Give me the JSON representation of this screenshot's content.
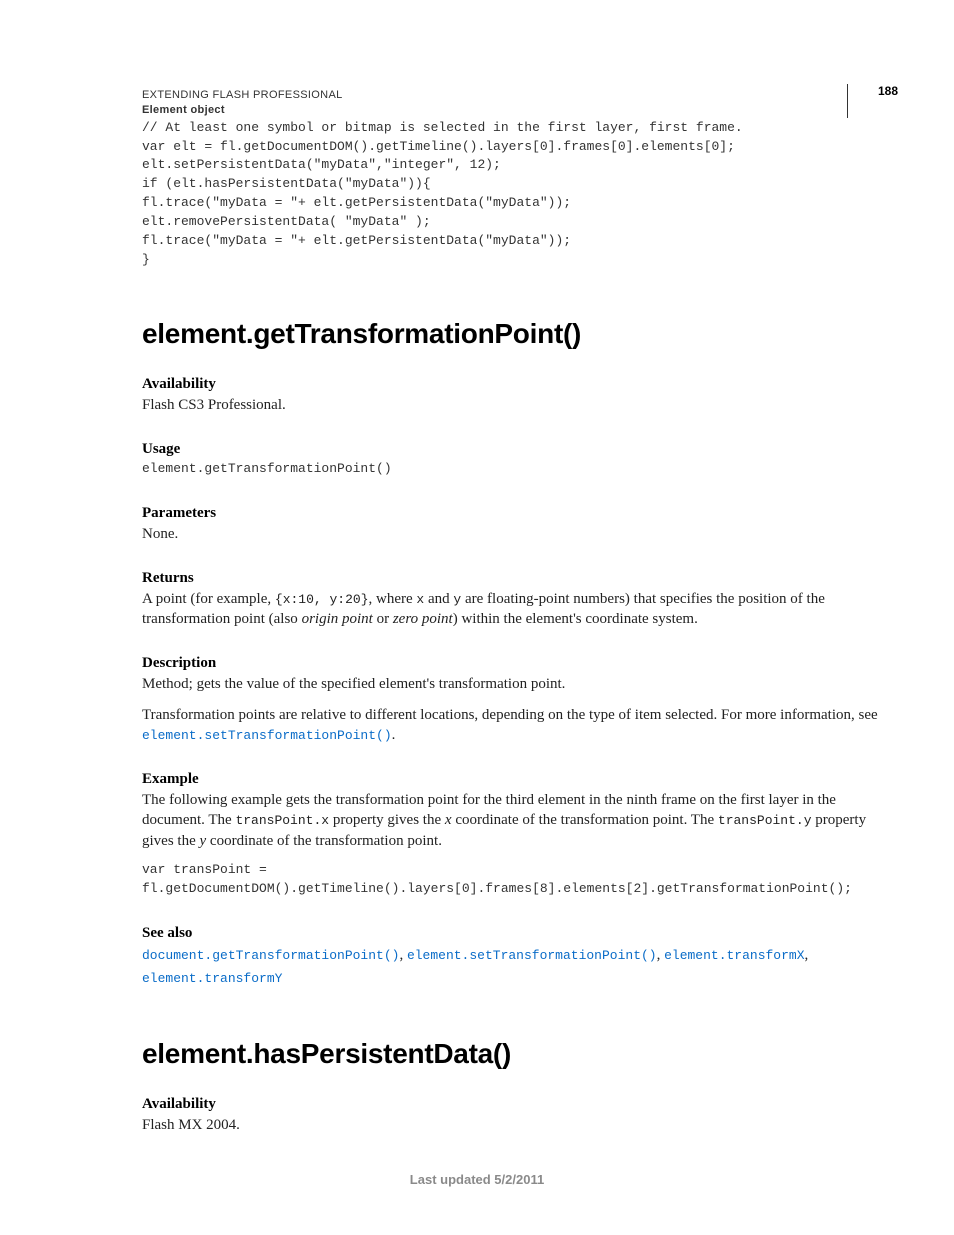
{
  "header": {
    "line1": "EXTENDING FLASH PROFESSIONAL",
    "line2": "Element object",
    "page": "188"
  },
  "code1": "// At least one symbol or bitmap is selected in the first layer, first frame.\nvar elt = fl.getDocumentDOM().getTimeline().layers[0].frames[0].elements[0];\nelt.setPersistentData(\"myData\",\"integer\", 12);\nif (elt.hasPersistentData(\"myData\")){\nfl.trace(\"myData = \"+ elt.getPersistentData(\"myData\"));\nelt.removePersistentData( \"myData\" );\nfl.trace(\"myData = \"+ elt.getPersistentData(\"myData\"));\n}",
  "s1": {
    "title": "element.getTransformationPoint()",
    "avail_h": "Availability",
    "avail_t": "Flash CS3 Professional.",
    "usage_h": "Usage",
    "usage_c": "element.getTransformationPoint()",
    "params_h": "Parameters",
    "params_t": "None.",
    "returns_h": "Returns",
    "returns_pre": "A point (for example, ",
    "returns_code": "{x:10, y:20}",
    "returns_mid1": ", where ",
    "returns_x": "x",
    "returns_mid2": " and ",
    "returns_y": "y",
    "returns_post": " are floating-point numbers) that specifies the position of the transformation point (also ",
    "returns_i1": "origin point",
    "returns_or": " or ",
    "returns_i2": "zero point",
    "returns_end": ") within the element's coordinate system.",
    "desc_h": "Description",
    "desc_t": "Method; gets the value of the specified element's transformation point.",
    "desc_p2a": "Transformation points are relative to different locations, depending on the type of item selected. For more information, see ",
    "desc_link": "element.setTransformationPoint()",
    "desc_dot": ".",
    "ex_h": "Example",
    "ex_p_a": "The following example gets the transformation point for the third element in the ninth frame on the first layer in the document. The ",
    "ex_c1": "transPoint.x",
    "ex_p_b": " property gives the ",
    "ex_i1": "x",
    "ex_p_c": " coordinate of the transformation point. The ",
    "ex_c2": "transPoint.y",
    "ex_p_d": " property gives the ",
    "ex_i2": "y",
    "ex_p_e": " coordinate of the transformation point.",
    "ex_code": "var transPoint = \nfl.getDocumentDOM().getTimeline().layers[0].frames[8].elements[2].getTransformationPoint();",
    "see_h": "See also",
    "see1": "document.getTransformationPoint()",
    "see2": "element.setTransformationPoint()",
    "see3": "element.transformX",
    "see4": "element.transformY",
    "comma": ", "
  },
  "s2": {
    "title": "element.hasPersistentData()",
    "avail_h": "Availability",
    "avail_t": "Flash MX 2004."
  },
  "footer": "Last updated 5/2/2011"
}
